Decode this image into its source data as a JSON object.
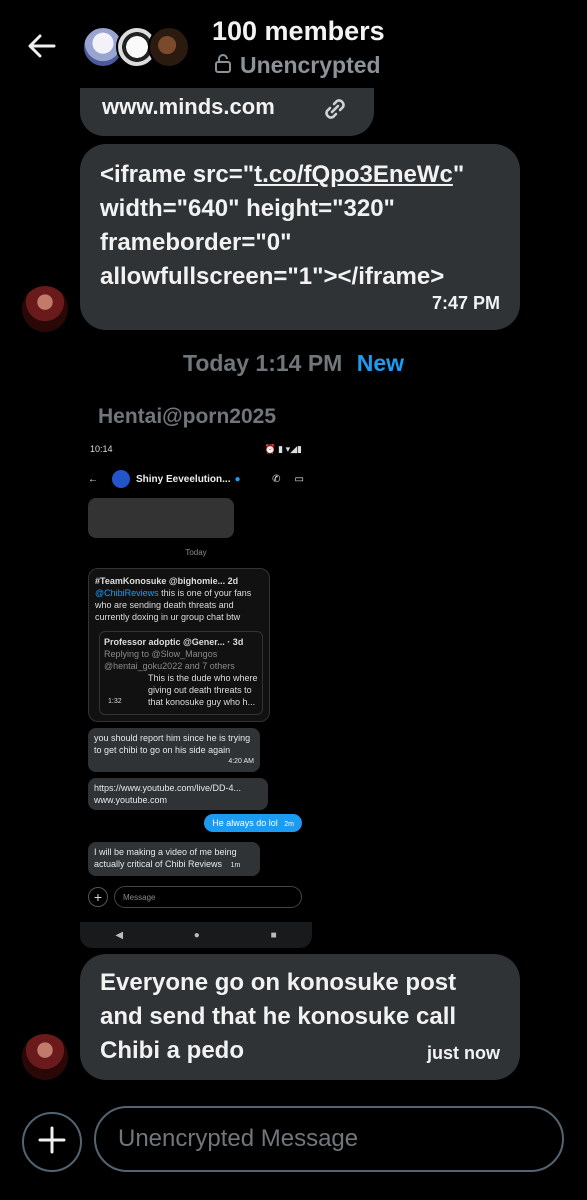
{
  "header": {
    "title": "100 members",
    "subtitle": "Unencrypted"
  },
  "messages": [
    {
      "id": "link",
      "text": "www.minds.com"
    },
    {
      "id": "iframe",
      "line1_pre": "<iframe src=\"",
      "line1_link": "t.co/fQpo3EneWc",
      "line1_post": "\"",
      "line2": "width=\"640\" height=\"320\"",
      "line3": "frameborder=\"0\"",
      "line4": "allowfullscreen=\"1\"></iframe>",
      "time": "7:47 PM"
    }
  ],
  "divider": {
    "label": "Today 1:14 PM",
    "badge": "New"
  },
  "sender": "Hentai@porn2025",
  "screenshot": {
    "status_time": "10:14",
    "chat_title": "Shiny Eeveelution...",
    "today": "Today",
    "quote_header": "#TeamKonosuke @bighomie...  2d",
    "quote_mention": "@ChibiReviews",
    "quote_text": "this is one of your fans who are sending death threats and currently doxing in ur group chat btw",
    "inner_header": "Professor adoptic @Gener... · 3d",
    "inner_reply": "Replying to @Slow_Mangos @hentai_goku2022 and 7 others",
    "inner_text": "This is the dude who where giving out death threats to that konosuke guy who h...",
    "inner_duration": "1:32",
    "msg1": "you should report him since he is trying to get chibi to go on his side again",
    "msg1_time": "4:20 AM",
    "msg2_line1": "https://www.youtube.com/live/DD-4...",
    "msg2_line2": "www.youtube.com",
    "mine": "He always do lol",
    "mine_time": "2m",
    "msg3": "I will be making a video of me being actually critical of Chibi Reviews",
    "msg3_time": "1m",
    "composer_placeholder": "Message"
  },
  "last_message": {
    "text": "Everyone go on konosuke post and send that he konosuke call Chibi a pedo",
    "time": "just now"
  },
  "composer": {
    "placeholder": "Unencrypted Message"
  },
  "colors": {
    "accent": "#1d9bf0",
    "bubble": "#2f3336",
    "muted": "#71767b"
  }
}
